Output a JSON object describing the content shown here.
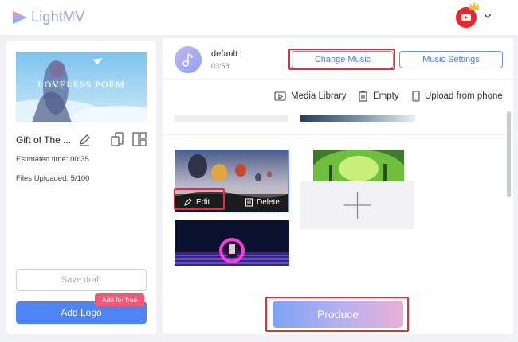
{
  "app": {
    "name": "LightMV"
  },
  "header": {
    "account_icon": "youtube-avatar-icon",
    "caret_icon": "chevron-down-icon"
  },
  "project": {
    "thumbnail_title": "LOVELESS POEM",
    "name": "Gift of The ...",
    "estimated_time_label": "Estimated time: 00:35",
    "files_uploaded_label": "Files Uploaded: 5/100",
    "save_draft_label": "Save draft",
    "add_logo_label": "Add Logo",
    "add_for_free_badge": "Add for free"
  },
  "music": {
    "track_name": "default",
    "duration": "03:58",
    "change_music_label": "Change Music",
    "music_settings_label": "Music Settings"
  },
  "toolbar": {
    "media_library_label": "Media Library",
    "empty_label": "Empty",
    "upload_from_phone_label": "Upload from phone"
  },
  "media": {
    "edit_label": "Edit",
    "delete_label": "Delete",
    "tiles": [
      "hot-air-balloons",
      "forest",
      "neon-portal"
    ]
  },
  "footer": {
    "produce_label": "Produce"
  },
  "colors": {
    "accent_blue": "#4d85f5",
    "highlight_red": "#e0303a",
    "badge_pink": "#f3587a"
  }
}
